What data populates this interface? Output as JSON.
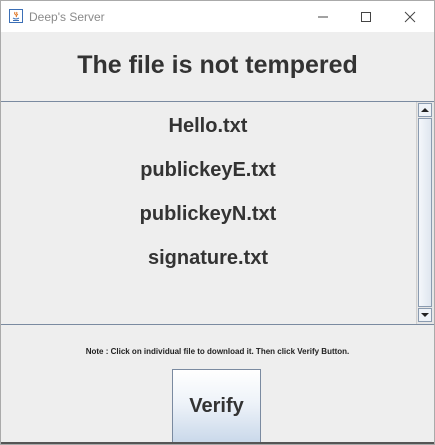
{
  "window": {
    "title": "Deep's Server",
    "icon": "java-cup-icon"
  },
  "heading": "The file is not tempered",
  "files": [
    "Hello.txt",
    "publickeyE.txt",
    "publickeyN.txt",
    "signature.txt"
  ],
  "note": "Note : Click on individual file to download it. Then click Verify Button.",
  "verify_button": "Verify"
}
